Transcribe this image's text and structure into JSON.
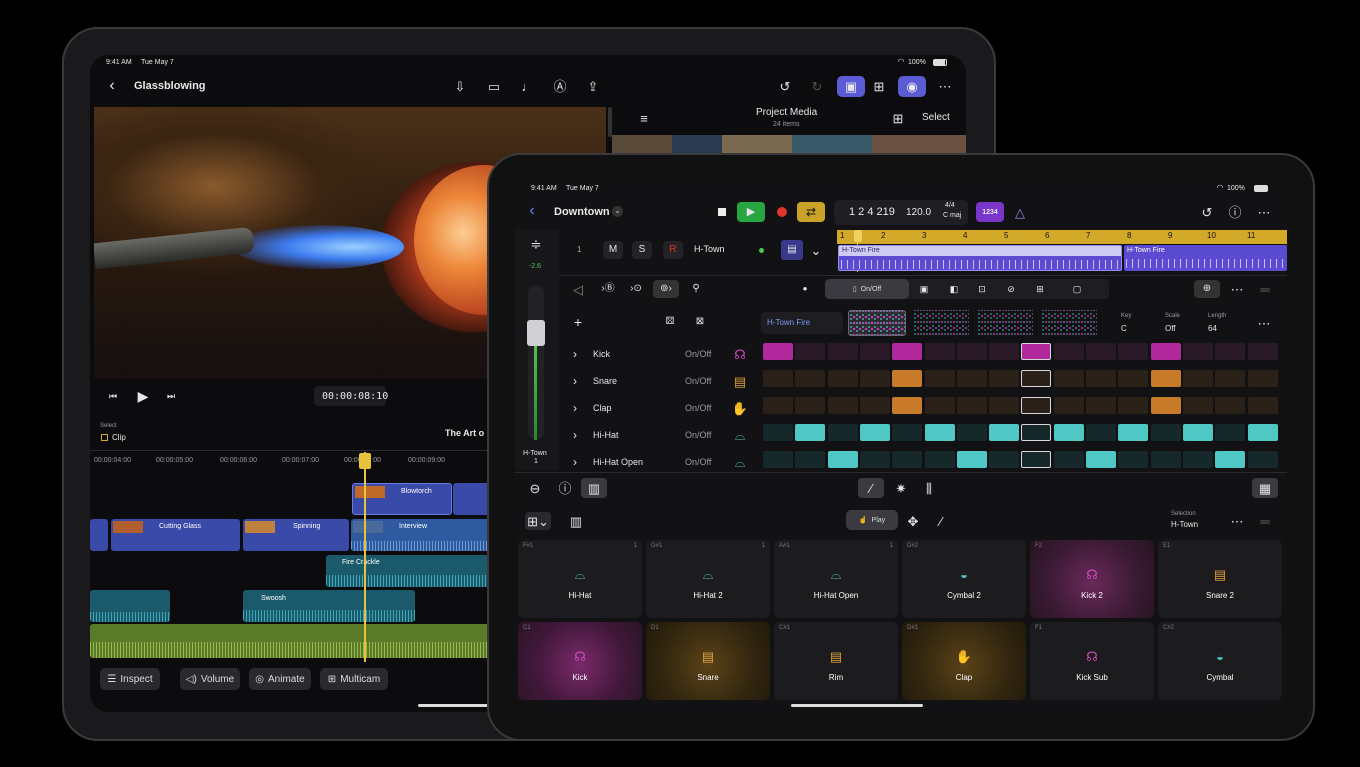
{
  "ipad_back": {
    "status": {
      "time": "9:41 AM",
      "date": "Tue May 7",
      "battery": "100%"
    },
    "project_title": "Glassblowing",
    "media": {
      "title": "Project Media",
      "count": "24 items",
      "select": "Select"
    },
    "timecode": "00:00:08:10",
    "select_label": "Select",
    "clip_label": "Clip",
    "clip_title": "The Art o",
    "ruler": [
      "00:00:04:00",
      "00:00:05:00",
      "00:00:06:00",
      "00:00:07:00",
      "00:00:08:00",
      "00:00:09:00"
    ],
    "clips": {
      "blowtorch": "Blowtorch",
      "cutting": "Cutting Glass",
      "spinning": "Spinning",
      "interview": "Interview",
      "fire": "Fire Crackle",
      "swoosh": "Swoosh"
    },
    "toolbar": {
      "inspect": "Inspect",
      "volume": "Volume",
      "animate": "Animate",
      "multicam": "Multicam"
    }
  },
  "ipad_front": {
    "status": {
      "time": "9:41 AM",
      "date": "Tue May 7",
      "battery": "100%"
    },
    "project_title": "Downtown",
    "lcd": {
      "position": "1 2 4 219",
      "tempo": "120.0",
      "sig": "4/4",
      "key": "C maj"
    },
    "count_in": "1234",
    "track": {
      "number": "1",
      "mute": "M",
      "solo": "S",
      "rec": "R",
      "name": "H-Town"
    },
    "volume_db": "-2.6",
    "channel_label": "H-Town",
    "channel_num": "1",
    "bars": [
      "1",
      "2",
      "3",
      "4",
      "5",
      "6",
      "7",
      "8",
      "9",
      "10",
      "11"
    ],
    "regions": [
      "H-Town Fire",
      "H-Town Fire"
    ],
    "onoff_tab": "On/Off",
    "pattern_name": "H-Town Fire",
    "key": {
      "label": "Key",
      "value": "C"
    },
    "scale": {
      "label": "Scale",
      "value": "Off"
    },
    "length": {
      "label": "Length",
      "value": "64"
    },
    "rows": [
      {
        "name": "Kick",
        "mode": "On/Off"
      },
      {
        "name": "Snare",
        "mode": "On/Off"
      },
      {
        "name": "Clap",
        "mode": "On/Off"
      },
      {
        "name": "Hi-Hat",
        "mode": "On/Off"
      },
      {
        "name": "Hi-Hat Open",
        "mode": "On/Off"
      }
    ],
    "play_label": "Play",
    "selection": {
      "label": "Selection",
      "value": "H-Town"
    },
    "pads": [
      {
        "key": "F#1",
        "count": "1",
        "name": "Hi-Hat"
      },
      {
        "key": "G#1",
        "count": "1",
        "name": "Hi-Hat 2"
      },
      {
        "key": "A#1",
        "count": "1",
        "name": "Hi-Hat Open"
      },
      {
        "key": "D#2",
        "count": "",
        "name": "Cymbal 2"
      },
      {
        "key": "F2",
        "count": "",
        "name": "Kick 2"
      },
      {
        "key": "E1",
        "count": "",
        "name": "Snare 2"
      },
      {
        "key": "C1",
        "count": "",
        "name": "Kick"
      },
      {
        "key": "D1",
        "count": "",
        "name": "Snare"
      },
      {
        "key": "C#1",
        "count": "",
        "name": "Rim"
      },
      {
        "key": "D#1",
        "count": "",
        "name": "Clap"
      },
      {
        "key": "F1",
        "count": "",
        "name": "Kick Sub"
      },
      {
        "key": "C#2",
        "count": "",
        "name": "Cymbal"
      }
    ]
  },
  "colors": {
    "accent_blue": "#5b5bd6",
    "kick": "#b0289b",
    "snare": "#c87a2b",
    "hihat": "#4fc7c4",
    "record": "#e0342e",
    "play": "#27a540",
    "loop": "#c9a227",
    "ruler": "#d3a92a",
    "region": "#5a4bd1"
  },
  "steps": {
    "kick": [
      1,
      0,
      0,
      0,
      1,
      0,
      0,
      0,
      1,
      0,
      0,
      0,
      1,
      0,
      0,
      0
    ],
    "snare": [
      0,
      0,
      0,
      0,
      1,
      0,
      0,
      0,
      0,
      0,
      0,
      0,
      1,
      0,
      0,
      0
    ],
    "clap": [
      0,
      0,
      0,
      0,
      1,
      0,
      0,
      0,
      0,
      0,
      0,
      0,
      1,
      0,
      0,
      0
    ],
    "hihat": [
      0,
      1,
      0,
      1,
      0,
      1,
      0,
      1,
      0,
      1,
      0,
      1,
      0,
      1,
      0,
      1
    ],
    "hihat_open": [
      0,
      0,
      1,
      0,
      0,
      0,
      1,
      0,
      0,
      0,
      1,
      0,
      0,
      0,
      1,
      0
    ]
  }
}
